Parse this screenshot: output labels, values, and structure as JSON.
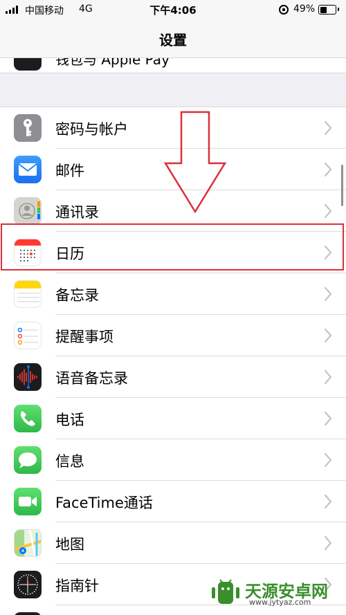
{
  "status_bar": {
    "carrier": "中国移动",
    "network": "4G",
    "time": "下午4:06",
    "battery_pct": "49%",
    "battery_level": 0.49
  },
  "nav": {
    "title": "设置"
  },
  "partial_row": {
    "label": "钱包与 Apple Pay"
  },
  "settings": {
    "items": [
      {
        "label": "密码与帐户",
        "icon": "key-icon",
        "color": "#8e8e93"
      },
      {
        "label": "邮件",
        "icon": "mail-icon",
        "color": "#1a82fb"
      },
      {
        "label": "通讯录",
        "icon": "contacts-icon",
        "color": "#c9c9c5"
      },
      {
        "label": "日历",
        "icon": "calendar-icon",
        "color": "#ff3b30"
      },
      {
        "label": "备忘录",
        "icon": "notes-icon",
        "color": "#ffd60a"
      },
      {
        "label": "提醒事项",
        "icon": "reminders-icon",
        "color": "#ffffff"
      },
      {
        "label": "语音备忘录",
        "icon": "voice-memos-icon",
        "color": "#1c1c1e"
      },
      {
        "label": "电话",
        "icon": "phone-icon",
        "color": "#34c759"
      },
      {
        "label": "信息",
        "icon": "messages-icon",
        "color": "#34c759"
      },
      {
        "label": "FaceTime通话",
        "icon": "facetime-icon",
        "color": "#34c759"
      },
      {
        "label": "地图",
        "icon": "maps-icon",
        "color": "#5ac15a"
      },
      {
        "label": "指南针",
        "icon": "compass-icon",
        "color": "#1c1c1e"
      }
    ]
  },
  "annotation": {
    "highlight_color": "#d9303a"
  },
  "watermark": {
    "title": "天源安卓网",
    "url": "www.jytyaz.com"
  }
}
